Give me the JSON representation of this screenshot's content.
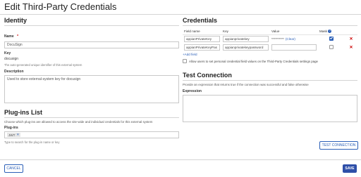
{
  "title": "Edit Third-Party Credentials",
  "identity": {
    "heading": "Identity",
    "name_label": "Name",
    "name_required": "*",
    "name_value": "DocuSign",
    "key_label": "Key",
    "key_value": "docusign",
    "key_hint": "The auto-generated unique identifier of this external system",
    "description_label": "Description",
    "description_value": "Used to store external-system key for docusign"
  },
  "plugins": {
    "heading": "Plug-ins List",
    "intro": "Choose which plug-ins are allowed to access the site-wide and individual credentials for this external system",
    "label": "Plug-ins",
    "chip": "JWT",
    "chip_remove": "✕",
    "hint": "Type to search for the plug-in name or key"
  },
  "credentials": {
    "heading": "Credentials",
    "columns": {
      "field_name": "Field name",
      "key": "Key",
      "value": "Value",
      "mask": "Mask",
      "help": "?"
    },
    "rows": [
      {
        "field_name": "appianPrivateKey",
        "key": "appianprivatekey",
        "value": "**********",
        "clear": "(Clear)",
        "masked": true,
        "delete": "✕"
      },
      {
        "field_name": "appianPrivateKeyPas",
        "key": "appianprivatekeypassword",
        "value": "",
        "clear": "",
        "masked": false,
        "delete": "✕"
      }
    ],
    "add_field": "+Add field",
    "allow_users": "Allow users to set personal credential field values on the Third-Party Credentials settings page"
  },
  "test": {
    "heading": "Test Connection",
    "intro": "Provide an expression that returns true if the connection was successful and false otherwise",
    "expression_label": "Expression",
    "button": "TEST CONNECTION"
  },
  "footer": {
    "cancel": "CANCEL",
    "save": "SAVE"
  },
  "colors": {
    "accent": "#2b5fb7",
    "save_bg": "#2e4fa8",
    "delete": "#cc0000"
  }
}
